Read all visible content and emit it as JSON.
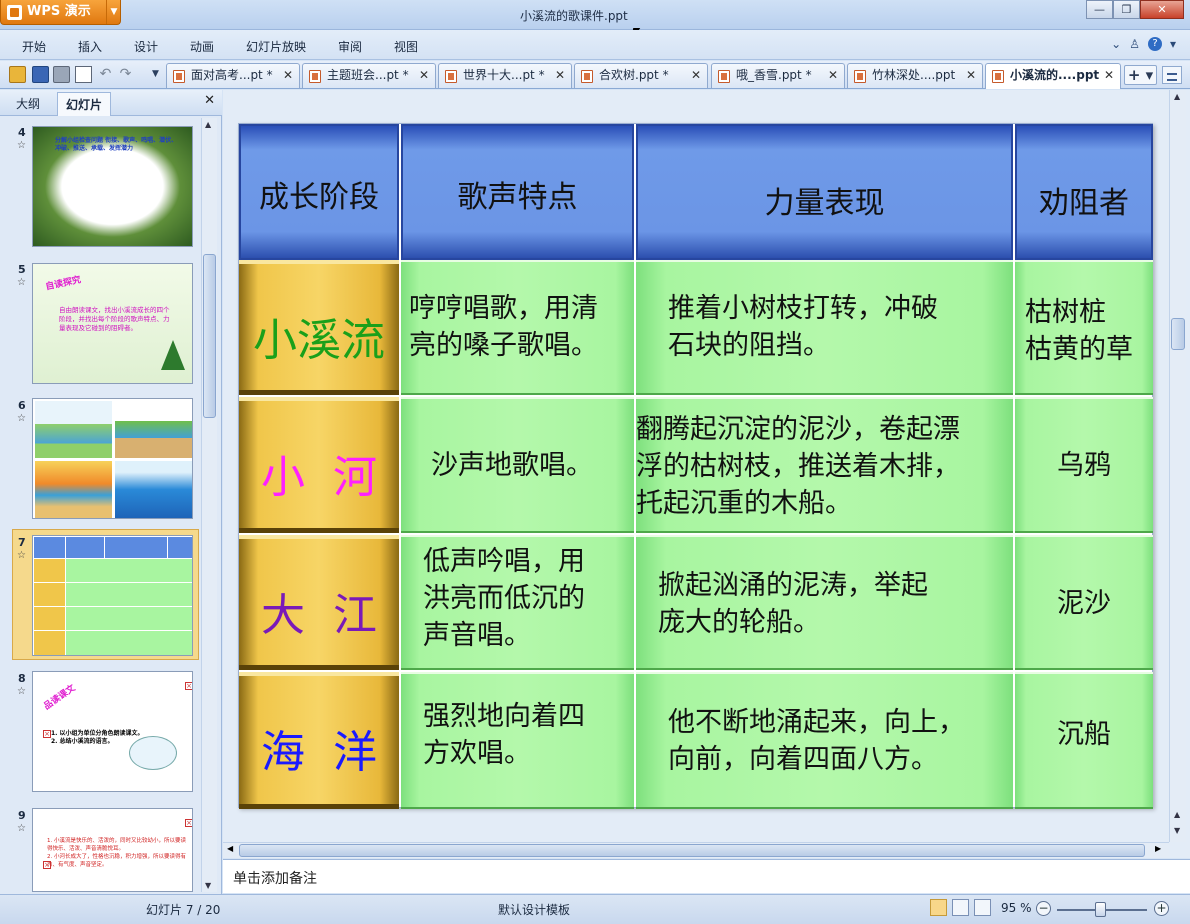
{
  "app": {
    "name": "WPS 演示",
    "window_title": "小溪流的歌课件.ppt"
  },
  "menu": [
    "开始",
    "插入",
    "设计",
    "动画",
    "幻灯片放映",
    "审阅",
    "视图"
  ],
  "doc_tabs": [
    {
      "label": "面对高考...pt *"
    },
    {
      "label": "主题班会...pt *"
    },
    {
      "label": "世界十大...pt *"
    },
    {
      "label": "合欢树.ppt *"
    },
    {
      "label": "哦_香雪.ppt *"
    },
    {
      "label": "竹林深处....ppt"
    },
    {
      "label": "小溪流的....ppt"
    }
  ],
  "left_panel": {
    "tabs": [
      "大纲",
      "幻灯片"
    ],
    "active_tab": "幻灯片",
    "slides": [
      {
        "num": "4",
        "star": "☆",
        "text": "分解小组检查问题 衔接、歌声、鸣唱、潜伏、冲破、推送、承载、发挥潜力"
      },
      {
        "num": "5",
        "star": "☆",
        "title": "自读探究",
        "text": "自由朗读课文，找出小溪流成长的四个阶段，并找出每个阶段的歌声特点、力量表现及它碰到的阻碍者。"
      },
      {
        "num": "6",
        "star": "☆"
      },
      {
        "num": "7",
        "star": "☆"
      },
      {
        "num": "8",
        "star": "☆",
        "title": "品读课文",
        "text": "1. 以小组为单位分角色朗读课文。\n2. 总结小溪流的语言。"
      },
      {
        "num": "9",
        "star": "☆",
        "text": "1. 小溪流是快乐的、活泼的，同时又比较幼小，所以要读得快乐、活泼、声音清脆悦耳。\n2. 小河长成大了，性格也沉稳，积力增强，所以要读得有力、有气度、声音坚定。"
      }
    ]
  },
  "table": {
    "headers": [
      "成长阶段",
      "歌声特点",
      "力量表现",
      "劝阻者"
    ],
    "rows": [
      {
        "stage": "小溪流",
        "stage_color": "#1aa01a",
        "song": "哼哼唱歌，用清\n亮的嗓子歌唱。",
        "power": "推着小树枝打转，冲破\n石块的阻挡。",
        "blocker": "枯树桩\n枯黄的草"
      },
      {
        "stage": "小  河",
        "stage_color": "#ff20ff",
        "song": "沙声地歌唱。",
        "power": "翻腾起沉淀的泥沙，卷起漂\n浮的枯树枝，推送着木排，\n托起沉重的木船。",
        "blocker": "乌鸦"
      },
      {
        "stage": "大  江",
        "stage_color": "#7a1ab8",
        "song": "低声吟唱，用\n洪亮而低沉的\n声音唱。",
        "power": "掀起汹涌的泥涛，举起\n庞大的轮船。",
        "blocker": "泥沙"
      },
      {
        "stage": "海  洋",
        "stage_color": "#1a1aff",
        "song": "强烈地向着四\n方欢唱。",
        "power": "他不断地涌起来，向上，\n向前，向着四面八方。",
        "blocker": "沉船"
      }
    ]
  },
  "notes_placeholder": "单击添加备注",
  "status": {
    "slide_indicator": "幻灯片 7 / 20",
    "template": "默认设计模板",
    "zoom": "95 %"
  }
}
